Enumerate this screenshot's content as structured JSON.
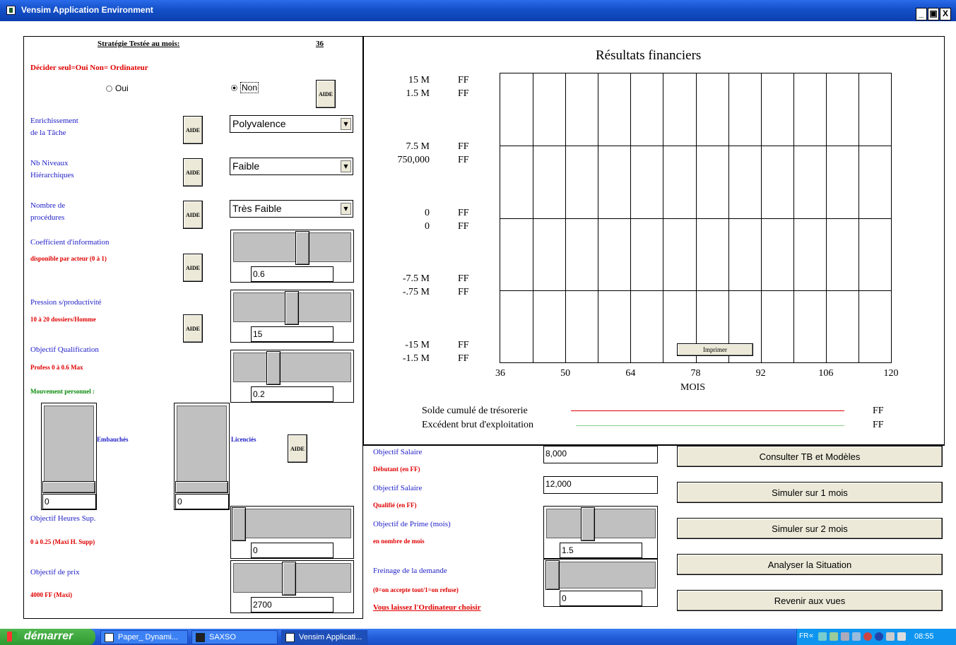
{
  "window": {
    "title": "Vensim Application Environment",
    "minimize": "_",
    "maximize": "▣",
    "close": "X"
  },
  "left": {
    "strategy_label": "Stratégie Testée au mois:",
    "strategy_month": "36",
    "decide_label": "Décider seul=Oui Non= Ordinateur",
    "radio_oui": "Oui",
    "radio_non": "Non",
    "aide": "AIDE",
    "enrich_line1": "Enrichissement",
    "enrich_line2": "de la Tâche",
    "enrich_value": "Polyvalence",
    "nb_niveaux_line1": "Nb Niveaux",
    "nb_niveaux_line2": "Hiérarchiques",
    "nb_niveaux_value": "Faible",
    "procedures_line1": "Nombre de",
    "procedures_line2": "procédures",
    "procedures_value": "Très Faible",
    "coef_label": "Coefficient d'information",
    "coef_sub": "disponible par acteur (0 à 1)",
    "coef_value": "0.6",
    "pression_label": "Pression s/productivité",
    "pression_sub": "10 à 20 dossiers/Homme",
    "pression_value": "15",
    "qualif_label": "Objectif Qualification",
    "qualif_sub": "Profess 0 à 0.6 Max",
    "qualif_value": "0.2",
    "mouvement_label": "Mouvement personnel :",
    "embauches_label": "Embauchés",
    "embauches_value": "0",
    "licencies_label": "Licenciés",
    "licencies_value": "0",
    "heures_label": "Objectif Heures Sup.",
    "heures_sub": "0 à 0.25 (Maxi H. Supp)",
    "heures_value": "0",
    "prix_label": "Objectif de prix",
    "prix_sub": "4000 FF (Maxi)",
    "prix_value": "2700"
  },
  "chart_data": {
    "type": "line",
    "title": "Résultats financiers",
    "xlabel": "MOIS",
    "x_ticks": [
      "36",
      "50",
      "64",
      "78",
      "92",
      "106",
      "120"
    ],
    "xlim": [
      36,
      120
    ],
    "y_ticks_primary": [
      "15 M",
      "7.5 M",
      "0",
      "-7.5 M",
      "-15 M"
    ],
    "y_ticks_secondary": [
      "1.5 M",
      "750,000",
      "0",
      "-.75 M",
      "-1.5 M"
    ],
    "y_unit": "FF",
    "grid": true,
    "series": [
      {
        "name": "Solde cumulé de trésorerie",
        "unit": "FF",
        "color": "#e00000",
        "values": []
      },
      {
        "name": "Excédent brut d'exploitation",
        "unit": "FF",
        "color": "#88cc88",
        "values": []
      }
    ],
    "print_button": "Imprimer"
  },
  "bottom_middle": {
    "salaire_deb_label": "Objectif Salaire",
    "salaire_deb_sub": "Débutant (en FF)",
    "salaire_deb_value": "8,000",
    "salaire_qual_label": "Objectif Salaire",
    "salaire_qual_sub": "Qualifié (en FF)",
    "salaire_qual_value": "12,000",
    "prime_label": "Objectif de Prime (mois)",
    "prime_sub": "en nombre de mois",
    "prime_value": "1.5",
    "freinage_label": "Freinage de la demande",
    "freinage_sub": "(0=on accepte tout/1=on refuse)",
    "freinage_value": "0",
    "ordinateur_link": "Vous laissez l'Ordinateur choisir"
  },
  "buttons": {
    "consulter": "Consulter TB et Modèles",
    "simuler1": "Simuler sur 1 mois",
    "simuler2": "Simuler sur 2 mois",
    "analyser": "Analyser la Situation",
    "revenir": "Revenir aux vues"
  },
  "taskbar": {
    "start": "démarrer",
    "task1": "Paper_ Dynami...",
    "task2": "SAXSO",
    "task3": "Vensim Applicati...",
    "lang": "FR",
    "clock": "08:55"
  }
}
